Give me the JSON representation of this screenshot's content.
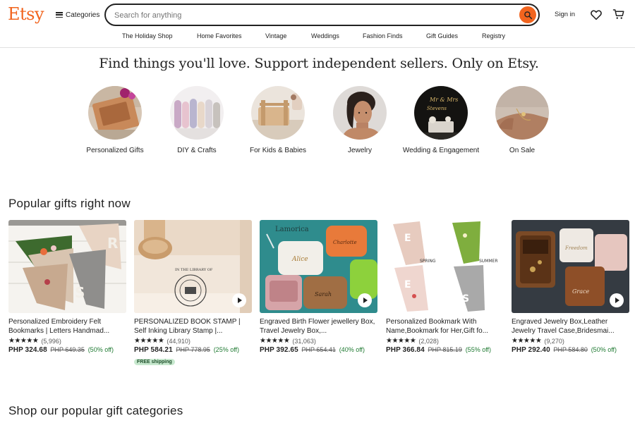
{
  "header": {
    "logo": "Etsy",
    "categories_label": "Categories",
    "search_placeholder": "Search for anything",
    "search_value": "",
    "signin_label": "Sign in"
  },
  "nav": [
    "The Holiday Shop",
    "Home Favorites",
    "Vintage",
    "Weddings",
    "Fashion Finds",
    "Gift Guides",
    "Registry"
  ],
  "tagline": "Find things you'll love. Support independent sellers. Only on Etsy.",
  "categories_circles": [
    {
      "label": "Personalized Gifts"
    },
    {
      "label": "DIY & Crafts"
    },
    {
      "label": "For Kids & Babies"
    },
    {
      "label": "Jewelry"
    },
    {
      "label": "Wedding & Engagement"
    },
    {
      "label": "On Sale"
    }
  ],
  "popular": {
    "title": "Popular gifts right now",
    "items": [
      {
        "title": "Personalized Embroidery Felt Bookmarks | Letters Handmad...",
        "stars": "★★★★★",
        "reviews": "(5,996)",
        "price": "PHP 324.68",
        "original": "PHP 649.35",
        "discount": "(50% off)",
        "badge": ""
      },
      {
        "title": "PERSONALIZED BOOK STAMP | Self Inking Library Stamp |...",
        "stars": "★★★★★",
        "reviews": "(44,910)",
        "price": "PHP 584.21",
        "original": "PHP 778.95",
        "discount": "(25% off)",
        "badge": "FREE shipping"
      },
      {
        "title": "Engraved Birth Flower jewellery Box, Travel Jewelry Box,...",
        "stars": "★★★★★",
        "reviews": "(31,063)",
        "price": "PHP 392.65",
        "original": "PHP 654.41",
        "discount": "(40% off)",
        "badge": ""
      },
      {
        "title": "Personalized Bookmark With Name,Bookmark for Her,Gift fo...",
        "stars": "★★★★★",
        "reviews": "(2,028)",
        "price": "PHP 366.84",
        "original": "PHP 815.19",
        "discount": "(55% off)",
        "badge": ""
      },
      {
        "title": "Engraved Jewelry Box,Leather Jewelry Travel Case,Bridesmai...",
        "stars": "★★★★★",
        "reviews": "(9,270)",
        "price": "PHP 292.40",
        "original": "PHP 584.80",
        "discount": "(50% off)",
        "badge": ""
      }
    ]
  },
  "image_text": {
    "stamp": "IN THE LIBRARY OF",
    "box_brand": "Lamorica",
    "box_name_1": "Alice",
    "box_name_2": "Charlotte",
    "box_name_3": "Sarah",
    "bookmark_spring": "SPRING",
    "bookmark_summer": "SUMMER",
    "leather_name_1": "Freedom",
    "leather_name_2": "Grace"
  },
  "categories_section_title": "Shop our popular gift categories",
  "colors": {
    "brand": "#f1641e",
    "discount": "#1f7a32",
    "badge_bg": "#c8e9cf"
  },
  "icons": [
    "menu-icon",
    "search-icon",
    "heart-icon",
    "cart-icon",
    "play-icon"
  ]
}
